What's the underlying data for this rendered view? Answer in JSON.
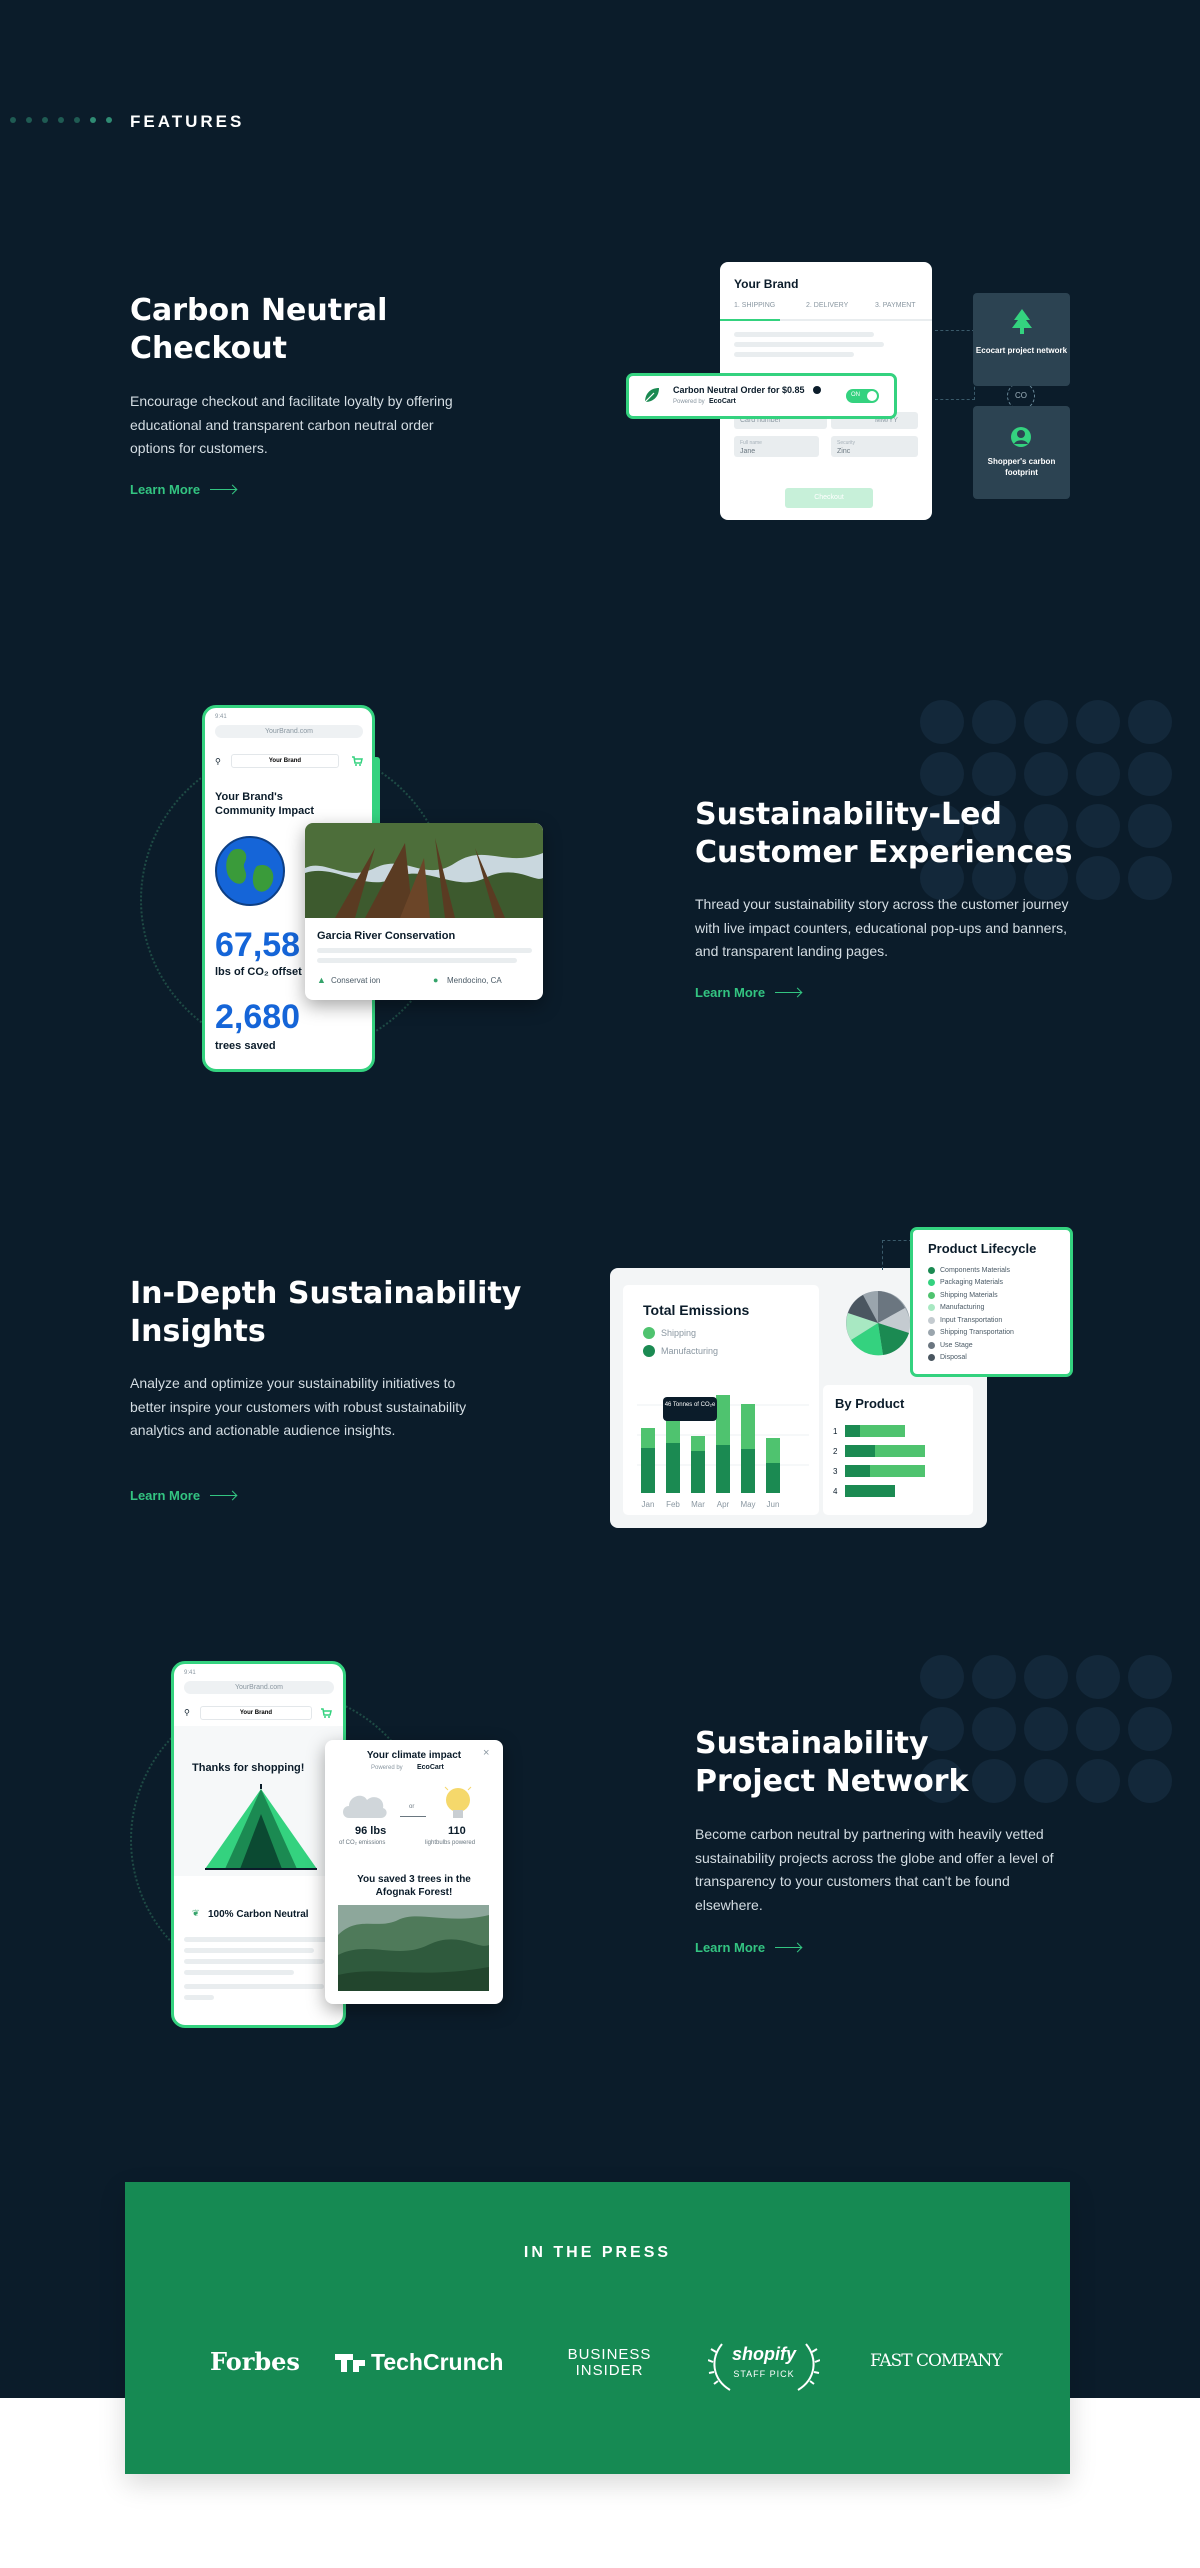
{
  "section": {
    "eyebrow": "FEATURES"
  },
  "features": [
    {
      "title": "Carbon Neutral\nCheckout",
      "description": "Encourage checkout and facilitate loyalty by offering educational and transparent carbon neutral order options for customers.",
      "link": "Learn More"
    },
    {
      "title": "Sustainability-Led\nCustomer Experiences",
      "description": "Thread your sustainability story across the customer journey with live impact counters, educational pop-ups and banners, and transparent landing pages.",
      "link": "Learn More"
    },
    {
      "title": "In-Depth Sustainability\nInsights",
      "description": "Analyze and optimize your sustainability initiatives to better inspire your customers with robust sustainability analytics and actionable audience insights.",
      "link": "Learn More"
    },
    {
      "title": "Sustainability\nProject Network",
      "description": "Become carbon neutral by partnering with heavily vetted sustainability projects across the globe and offer a level of transparency to your customers that can't be found elsewhere.",
      "link": "Learn More"
    }
  ],
  "checkout_mock": {
    "brand": "Your Brand",
    "steps": [
      "1. SHIPPING",
      "2. DELIVERY",
      "3. PAYMENT"
    ],
    "offer": "Carbon Neutral Order for $0.85",
    "powered": "Powered by",
    "ecocart": "EcoCart",
    "toggle": "ON",
    "card_number": "Card number",
    "expiry": "MM/YY",
    "field_a_label": "Full name",
    "field_a": "Jane",
    "field_b_label": "Security",
    "field_b": "Zinc",
    "checkout_btn": "Checkout",
    "network_node": "Ecocart project network",
    "shopper_node": "Shopper's carbon footprint",
    "connector": "CO"
  },
  "impact_mock": {
    "url": "YourBrand.com",
    "time": "9:41",
    "brand": "Your Brand",
    "heading": "Your Brand's Community Impact",
    "stat1": "67,58",
    "stat1_label": "lbs of CO₂ offset",
    "stat2": "2,680",
    "stat2_label": "trees saved",
    "project_title": "Garcia River Conservation",
    "tag1": "Conservat ion",
    "tag2": "Mendocino, CA"
  },
  "insights_mock": {
    "total_title": "Total Emissions",
    "legend": [
      "Shipping",
      "Manufacturing"
    ],
    "tooltip": "46 Tonnes of CO₂e",
    "months": [
      "Jan",
      "Feb",
      "Mar",
      "Apr",
      "May",
      "Jun"
    ],
    "by_product": "By Product",
    "products": [
      "1",
      "2",
      "3",
      "4"
    ],
    "lifecycle_title": "Product Lifecycle",
    "lifecycle_items": [
      "Components Materials",
      "Packaging Materials",
      "Shipping Materials",
      "Manufacturing",
      "Input Transportation",
      "Shipping Transportation",
      "Use Stage",
      "Disposal"
    ],
    "colors": {
      "dark_green": "#1b8a52",
      "light_green": "#4fc36f",
      "accent": "#34d27f"
    }
  },
  "network_mock": {
    "url": "YourBrand.com",
    "time": "9:41",
    "brand": "Your Brand",
    "thanks": "Thanks for shopping!",
    "neutral": "100% Carbon Neutral",
    "popup_title": "Your climate impact",
    "popup_powered": "Powered by",
    "ecocart": "EcoCart",
    "lbs": "96 lbs",
    "lbs_label": "of CO₂ emissions",
    "or": "or",
    "bulbs": "110",
    "bulbs_label": "lightbulbs powered",
    "saved": "You saved 3 trees in the Afognak Forest!",
    "close": "×"
  },
  "press": {
    "title": "IN THE PRESS",
    "logos": [
      "Forbes",
      "TechCrunch",
      "BUSINESS INSIDER",
      "shopify",
      "STAFF PICK",
      "FAST COMPANY"
    ]
  }
}
